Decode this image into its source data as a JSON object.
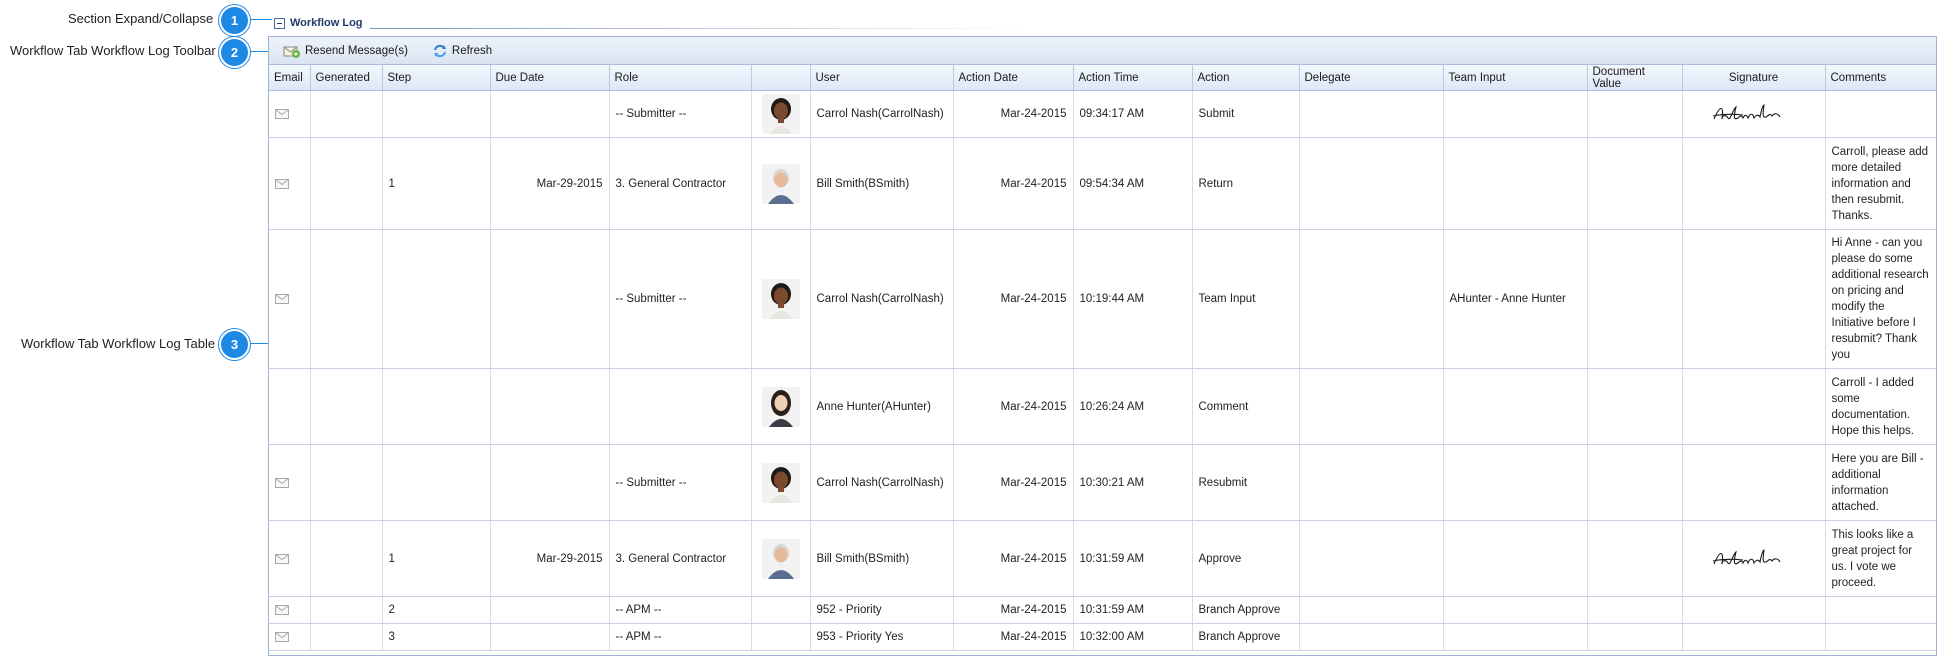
{
  "callouts": [
    {
      "number": "1",
      "label": "Section Expand/Collapse"
    },
    {
      "number": "2",
      "label": "Workflow Tab Workflow Log Toolbar"
    },
    {
      "number": "3",
      "label": "Workflow Tab Workflow Log Table"
    }
  ],
  "section": {
    "title": "Workflow Log"
  },
  "toolbar": {
    "resend_label": "Resend Message(s)",
    "refresh_label": "Refresh"
  },
  "table": {
    "columns": [
      "Email",
      "Generated",
      "Step",
      "Due Date",
      "Role",
      "",
      "User",
      "Action Date",
      "Action Time",
      "Action",
      "Delegate",
      "Team Input",
      "Document Value",
      "Signature",
      "Comments"
    ],
    "rows": [
      {
        "email": true,
        "generated": "",
        "step": "",
        "due_date": "",
        "role": "-- Submitter --",
        "avatar": "woman-dark",
        "user": "Carrol Nash(CarrolNash)",
        "action_date": "Mar-24-2015",
        "action_time": "09:34:17 AM",
        "action": "Submit",
        "delegate": "",
        "team_input": "",
        "document_value": "",
        "signature": true,
        "comments": ""
      },
      {
        "email": true,
        "generated": "",
        "step": "1",
        "due_date": "Mar-29-2015",
        "role": "3. General Contractor",
        "avatar": "man-grey",
        "user": "Bill Smith(BSmith)",
        "action_date": "Mar-24-2015",
        "action_time": "09:54:34 AM",
        "action": "Return",
        "delegate": "",
        "team_input": "",
        "document_value": "",
        "signature": false,
        "comments": "Carroll, please add more detailed information and then resubmit. Thanks."
      },
      {
        "email": true,
        "generated": "",
        "step": "",
        "due_date": "",
        "role": "-- Submitter --",
        "avatar": "woman-dark",
        "user": "Carrol Nash(CarrolNash)",
        "action_date": "Mar-24-2015",
        "action_time": "10:19:44 AM",
        "action": "Team Input",
        "delegate": "",
        "team_input": "AHunter - Anne Hunter",
        "document_value": "",
        "signature": false,
        "comments": "Hi Anne - can you please do some additional research on pricing and modify the Initiative before I resubmit? Thank you"
      },
      {
        "email": false,
        "generated": "",
        "step": "",
        "due_date": "",
        "role": "",
        "avatar": "woman-light",
        "user": "Anne Hunter(AHunter)",
        "action_date": "Mar-24-2015",
        "action_time": "10:26:24 AM",
        "action": "Comment",
        "delegate": "",
        "team_input": "",
        "document_value": "",
        "signature": false,
        "comments": "Carroll - I added some documentation. Hope this helps."
      },
      {
        "email": true,
        "generated": "",
        "step": "",
        "due_date": "",
        "role": "-- Submitter --",
        "avatar": "woman-dark",
        "user": "Carrol Nash(CarrolNash)",
        "action_date": "Mar-24-2015",
        "action_time": "10:30:21 AM",
        "action": "Resubmit",
        "delegate": "",
        "team_input": "",
        "document_value": "",
        "signature": false,
        "comments": "Here you are Bill - additional information attached."
      },
      {
        "email": true,
        "generated": "",
        "step": "1",
        "due_date": "Mar-29-2015",
        "role": "3. General Contractor",
        "avatar": "man-grey",
        "user": "Bill Smith(BSmith)",
        "action_date": "Mar-24-2015",
        "action_time": "10:31:59 AM",
        "action": "Approve",
        "delegate": "",
        "team_input": "",
        "document_value": "",
        "signature": true,
        "comments": "This looks like a great project for us. I vote we proceed."
      },
      {
        "email": true,
        "generated": "",
        "step": "2",
        "due_date": "",
        "role": "-- APM --",
        "avatar": "",
        "user": "952 - Priority",
        "action_date": "Mar-24-2015",
        "action_time": "10:31:59 AM",
        "action": "Branch Approve",
        "delegate": "",
        "team_input": "",
        "document_value": "",
        "signature": false,
        "comments": ""
      },
      {
        "email": true,
        "generated": "",
        "step": "3",
        "due_date": "",
        "role": "-- APM --",
        "avatar": "",
        "user": "953 - Priority Yes",
        "action_date": "Mar-24-2015",
        "action_time": "10:32:00 AM",
        "action": "Branch Approve",
        "delegate": "",
        "team_input": "",
        "document_value": "",
        "signature": false,
        "comments": ""
      }
    ]
  },
  "colors": {
    "accent": "#1e88e5",
    "header_text": "#1f3a6b",
    "grid_border": "#9fb4d3"
  }
}
